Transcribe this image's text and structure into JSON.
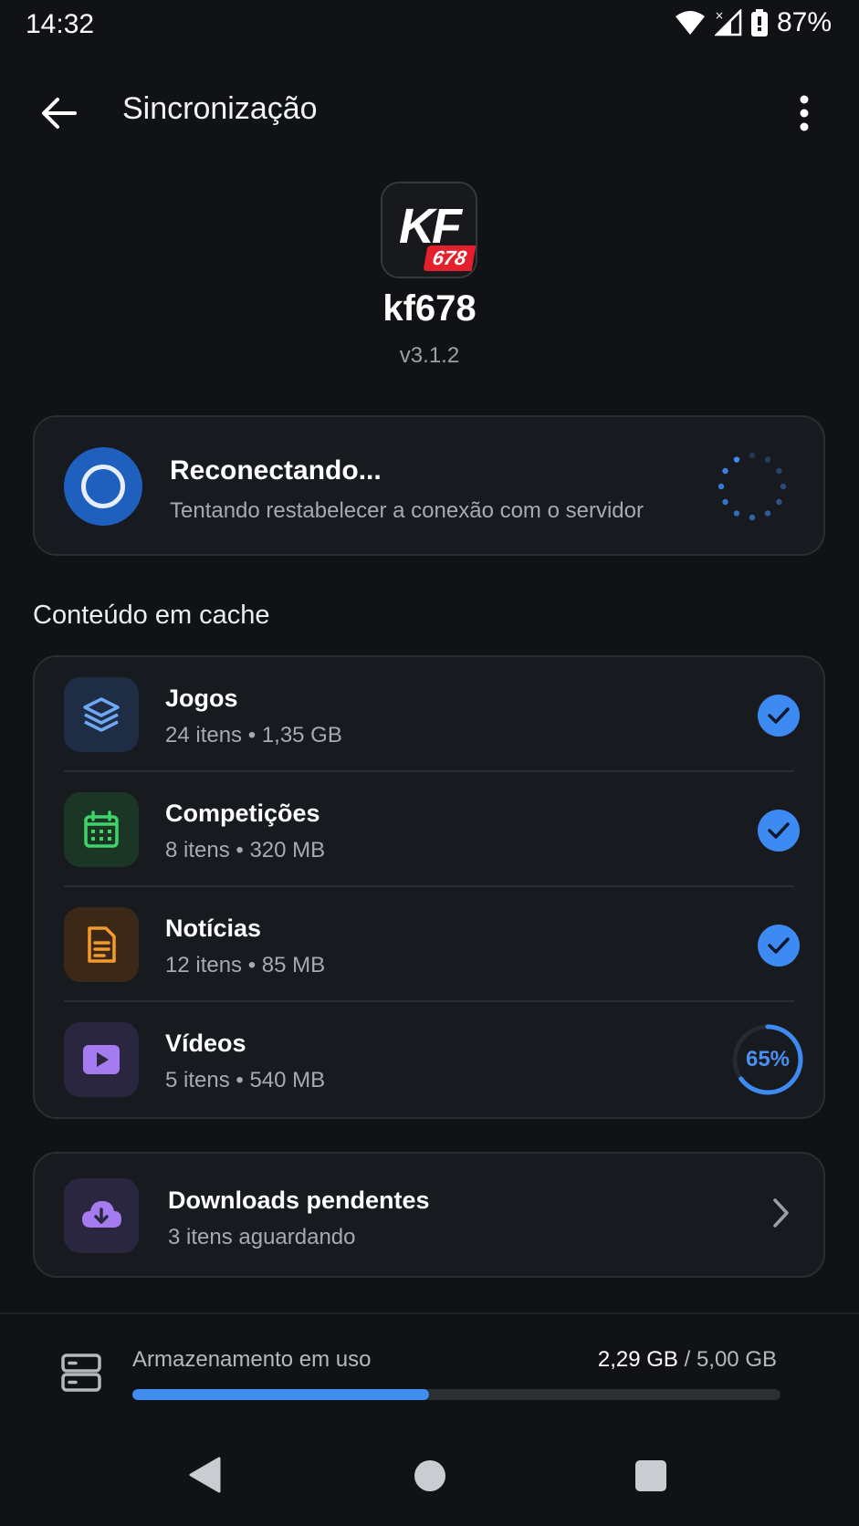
{
  "status_bar": {
    "time": "14:32",
    "battery": "87%"
  },
  "app_bar": {
    "title": "Sincronização"
  },
  "header": {
    "logo_text": "KF",
    "logo_badge": "678",
    "name": "kf678",
    "version": "v3.1.2"
  },
  "reconnect": {
    "title": "Reconectando...",
    "subtitle": "Tentando restabelecer a conexão com o servidor"
  },
  "cache": {
    "section_title": "Conteúdo em cache",
    "items": [
      {
        "name": "Jogos",
        "meta": "24 itens • 1,35 GB",
        "icon": "layers-icon",
        "status": "done"
      },
      {
        "name": "Competições",
        "meta": "8 itens • 320 MB",
        "icon": "calendar-icon",
        "status": "done"
      },
      {
        "name": "Notícias",
        "meta": "12 itens • 85 MB",
        "icon": "document-icon",
        "status": "done"
      },
      {
        "name": "Vídeos",
        "meta": "5 itens • 540 MB",
        "icon": "play-icon",
        "status": "progress",
        "progress": 0.65,
        "progress_label": "65%"
      }
    ]
  },
  "downloads": {
    "title": "Downloads pendentes",
    "subtitle": "3 itens aguardando"
  },
  "storage": {
    "label": "Armazenamento em uso",
    "used": "2,29 GB",
    "total": "/ 5,00 GB",
    "fraction": 0.458
  },
  "colors": {
    "accent": "#3d8bf2",
    "background": "#101215",
    "card": "#171a1e"
  }
}
